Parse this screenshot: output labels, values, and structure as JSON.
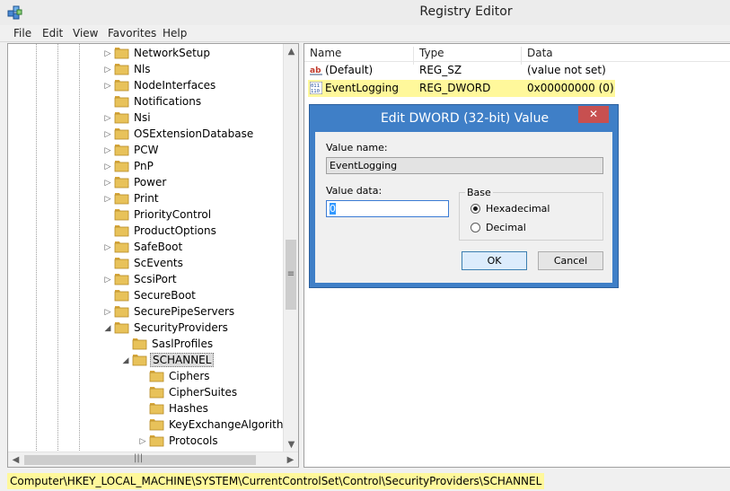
{
  "window": {
    "title": "Registry Editor"
  },
  "menu": [
    "File",
    "Edit",
    "View",
    "Favorites",
    "Help"
  ],
  "tree": {
    "items": [
      {
        "label": "NetworkSetup",
        "expand": "collapsed",
        "level": 0
      },
      {
        "label": "Nls",
        "expand": "collapsed",
        "level": 0
      },
      {
        "label": "NodeInterfaces",
        "expand": "collapsed",
        "level": 0
      },
      {
        "label": "Notifications",
        "expand": "none",
        "level": 0
      },
      {
        "label": "Nsi",
        "expand": "collapsed",
        "level": 0
      },
      {
        "label": "OSExtensionDatabase",
        "expand": "collapsed",
        "level": 0
      },
      {
        "label": "PCW",
        "expand": "collapsed",
        "level": 0
      },
      {
        "label": "PnP",
        "expand": "collapsed",
        "level": 0
      },
      {
        "label": "Power",
        "expand": "collapsed",
        "level": 0
      },
      {
        "label": "Print",
        "expand": "collapsed",
        "level": 0
      },
      {
        "label": "PriorityControl",
        "expand": "none",
        "level": 0
      },
      {
        "label": "ProductOptions",
        "expand": "none",
        "level": 0
      },
      {
        "label": "SafeBoot",
        "expand": "collapsed",
        "level": 0
      },
      {
        "label": "ScEvents",
        "expand": "none",
        "level": 0
      },
      {
        "label": "ScsiPort",
        "expand": "collapsed",
        "level": 0
      },
      {
        "label": "SecureBoot",
        "expand": "none",
        "level": 0
      },
      {
        "label": "SecurePipeServers",
        "expand": "collapsed",
        "level": 0
      },
      {
        "label": "SecurityProviders",
        "expand": "expanded",
        "level": 0
      },
      {
        "label": "SaslProfiles",
        "expand": "none",
        "level": 1
      },
      {
        "label": "SCHANNEL",
        "expand": "expanded",
        "level": 1,
        "selected": true
      },
      {
        "label": "Ciphers",
        "expand": "none",
        "level": 2
      },
      {
        "label": "CipherSuites",
        "expand": "none",
        "level": 2
      },
      {
        "label": "Hashes",
        "expand": "none",
        "level": 2
      },
      {
        "label": "KeyExchangeAlgorithms",
        "expand": "none",
        "level": 2
      },
      {
        "label": "Protocols",
        "expand": "collapsed",
        "level": 2
      }
    ]
  },
  "list": {
    "columns": [
      "Name",
      "Type",
      "Data"
    ],
    "rows": [
      {
        "icon": "string-value-icon",
        "name": "(Default)",
        "type": "REG_SZ",
        "data": "(value not set)",
        "highlight": false
      },
      {
        "icon": "binary-value-icon",
        "name": "EventLogging",
        "type": "REG_DWORD",
        "data": "0x00000000 (0)",
        "highlight": true
      }
    ]
  },
  "dialog": {
    "title": "Edit DWORD (32-bit) Value",
    "close_glyph": "✕",
    "value_name_label": "Value name:",
    "value_name": "EventLogging",
    "value_data_label": "Value data:",
    "value_data": "0",
    "base_label": "Base",
    "base_options": [
      {
        "label": "Hexadecimal",
        "selected": true
      },
      {
        "label": "Decimal",
        "selected": false
      }
    ],
    "ok_label": "OK",
    "cancel_label": "Cancel"
  },
  "status": {
    "path": "Computer\\HKEY_LOCAL_MACHINE\\SYSTEM\\CurrentControlSet\\Control\\SecurityProviders\\SCHANNEL"
  },
  "colors": {
    "highlight": "#fff89b",
    "dialog_frame": "#3f7fc7",
    "close_button": "#c75050",
    "folder": "#e8c25a"
  }
}
